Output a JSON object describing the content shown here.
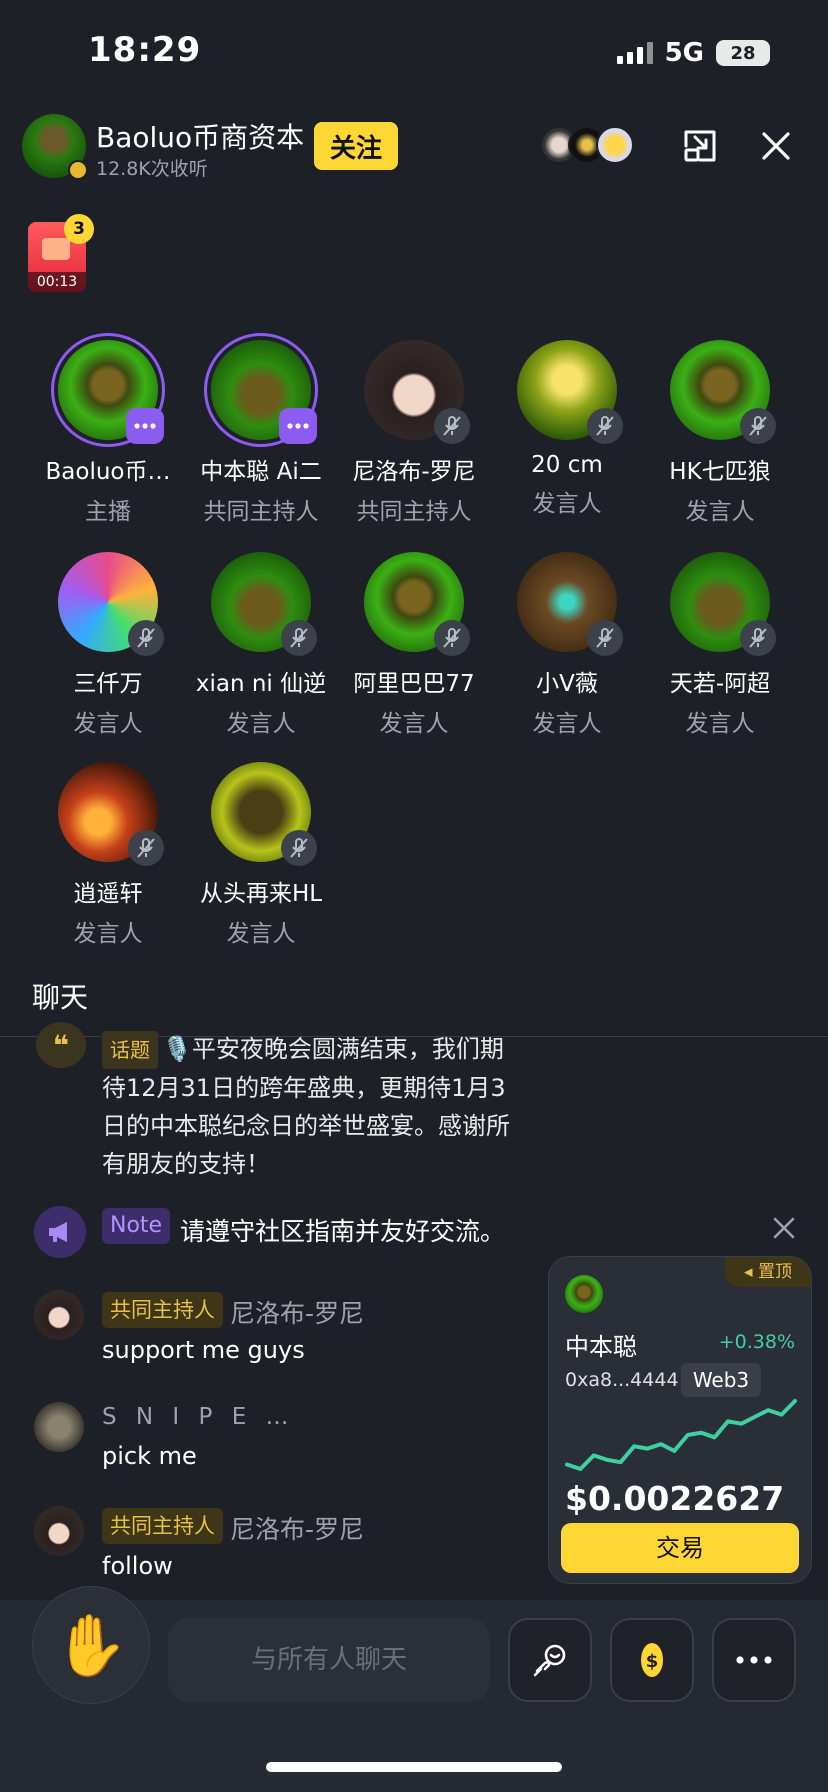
{
  "status": {
    "time": "18:29",
    "network": "5G",
    "battery": "28"
  },
  "header": {
    "title": "Baoluo币商资本",
    "listens": "12.8K次收听",
    "follow_label": "关注"
  },
  "recording": {
    "badge": "3",
    "time": "00:13"
  },
  "speakers": [
    {
      "name": "Baoluo币…",
      "role": "主播"
    },
    {
      "name": "中本聪 Ai二",
      "role": "共同主持人"
    },
    {
      "name": "尼洛布-罗尼",
      "role": "共同主持人"
    },
    {
      "name": "20 cm",
      "role": "发言人"
    },
    {
      "name": "HK七匹狼",
      "role": "发言人"
    },
    {
      "name": "三仟万",
      "role": "发言人"
    },
    {
      "name": "xian ni 仙逆",
      "role": "发言人"
    },
    {
      "name": "阿里巴巴77",
      "role": "发言人"
    },
    {
      "name": "小V薇",
      "role": "发言人"
    },
    {
      "name": "天若-阿超",
      "role": "发言人"
    },
    {
      "name": "逍遥轩",
      "role": "发言人"
    },
    {
      "name": "从头再来HL",
      "role": "发言人"
    }
  ],
  "chat": {
    "title": "聊天",
    "topic_tag": "话题",
    "topic_text": "🎙️平安夜晚会圆满结束，我们期待12月31日的跨年盛典，更期待1月3日的中本聪纪念日的举世盛宴。感谢所有朋友的支持！",
    "note_tag": "Note",
    "note_text": "请遵守社区指南并友好交流。",
    "messages": [
      {
        "tag": "共同主持人",
        "name": "尼洛布-罗尼",
        "text": "support me guys"
      },
      {
        "tag": "",
        "name": "S N I P E …",
        "text": "pick me"
      },
      {
        "tag": "共同主持人",
        "name": "尼洛布-罗尼",
        "text": "follow"
      }
    ]
  },
  "token": {
    "pin_label": "置顶",
    "name": "中本聪",
    "change": "+0.38%",
    "address": "0xa8...4444",
    "chain": "Web3",
    "price": "$0.0022627",
    "trade_label": "交易",
    "sparkline": [
      22,
      18,
      30,
      26,
      24,
      38,
      36,
      40,
      34,
      48,
      50,
      46,
      60,
      58,
      64,
      70,
      66,
      78
    ]
  },
  "bottom": {
    "input_placeholder": "与所有人聊天"
  },
  "colors": {
    "accent_yellow": "#ffd735",
    "accent_purple": "#8c5cf0",
    "positive_green": "#3fd0a0",
    "background": "#1d2027"
  }
}
